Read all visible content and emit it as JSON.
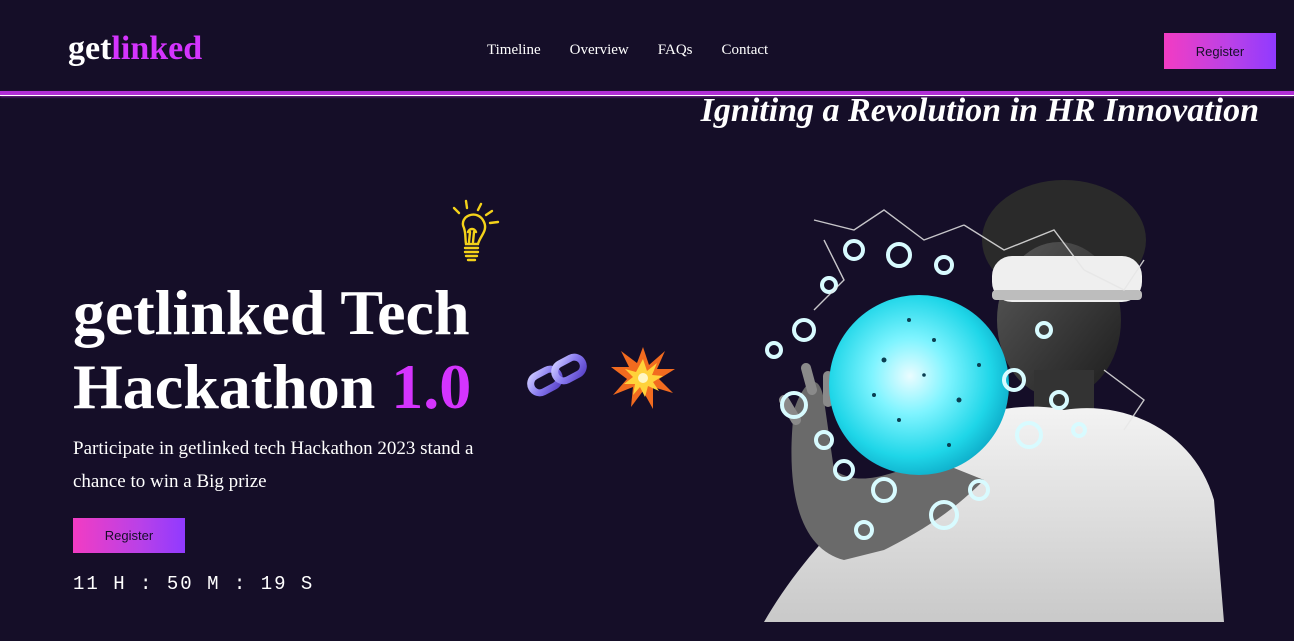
{
  "header": {
    "logo_part1": "get",
    "logo_part2": "linked",
    "nav": [
      {
        "label": "Timeline"
      },
      {
        "label": "Overview"
      },
      {
        "label": "FAQs"
      },
      {
        "label": "Contact"
      }
    ],
    "register_label": "Register"
  },
  "hero": {
    "tagline": "Igniting a Revolution in HR Innovation",
    "title_line1": "getlinked Tech",
    "title_line2_word": "Hackathon",
    "title_line2_accent": "1.0",
    "subtitle": "Participate in getlinked tech Hackathon 2023 stand a chance to win a Big prize",
    "register_label": "Register",
    "countdown": {
      "hours": "11",
      "h_unit": "H",
      "minutes": "50",
      "m_unit": "M",
      "seconds": "19",
      "s_unit": "S"
    }
  },
  "icons": {
    "bulb": "lightbulb-icon",
    "chain": "chain-link-icon",
    "burst": "explosion-icon"
  },
  "colors": {
    "background": "#150e28",
    "accent": "#d434fe",
    "button_gradient_start": "#f23cc3",
    "button_gradient_end": "#903aff"
  }
}
